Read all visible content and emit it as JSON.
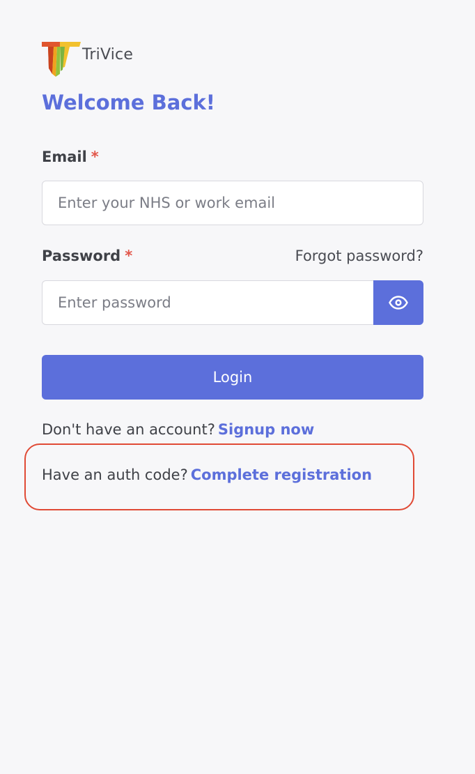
{
  "brand": {
    "name": "TriVice",
    "logo_icon": "trivice-logo-icon"
  },
  "title": "Welcome Back!",
  "email": {
    "label": "Email",
    "required_mark": "*",
    "placeholder": "Enter your NHS or work email",
    "value": ""
  },
  "password": {
    "label": "Password",
    "required_mark": "*",
    "placeholder": "Enter password",
    "value": "",
    "forgot_label": "Forgot password?",
    "toggle_icon": "eye-icon"
  },
  "login": {
    "label": "Login"
  },
  "signup": {
    "prompt": "Don't have an account?",
    "link": "Signup now"
  },
  "auth": {
    "prompt": "Have an auth code?",
    "link": "Complete registration"
  },
  "colors": {
    "accent": "#5c6fdb",
    "required": "#e2574b",
    "highlight": "#e04a35",
    "background": "#f7f7f9"
  }
}
